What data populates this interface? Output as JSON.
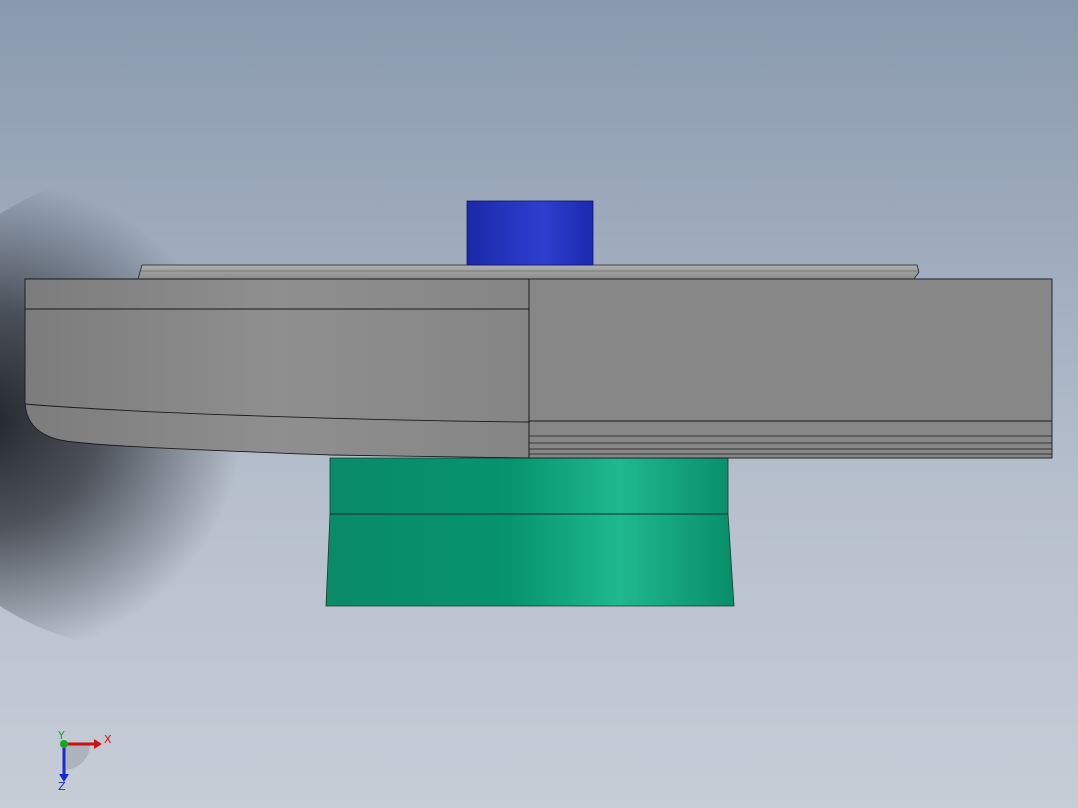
{
  "triad": {
    "x_label": "X",
    "y_label": "Y",
    "z_label": "Z"
  },
  "colors": {
    "background_top": "#8a9aae",
    "background_bottom": "#c6cdd7",
    "housing_gray": "#8a8a8a",
    "top_cap_blue": "#2533b5",
    "bottom_body_green": "#0c9a74",
    "axis_x_red": "#cc1111",
    "axis_y_green": "#11aa22",
    "axis_z_blue": "#1a2ad0"
  },
  "icons": [
    "coordinate-triad-icon"
  ]
}
